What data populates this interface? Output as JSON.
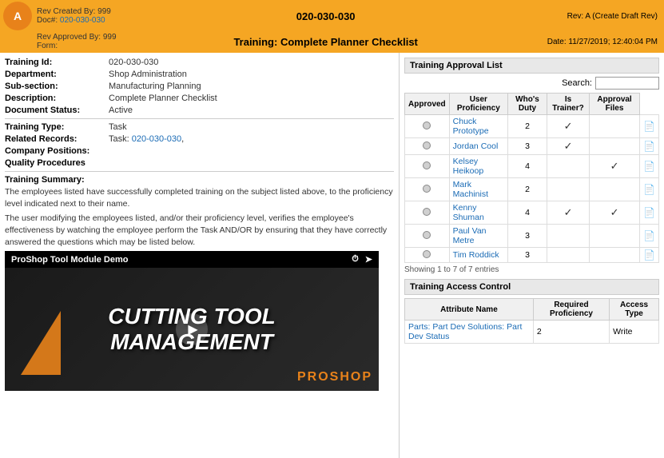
{
  "header": {
    "rev_created": "Rev Created By: 999",
    "doc_label": "Doc#:",
    "doc_number": "020-030-030",
    "rev_approved": "Rev Approved By: 999",
    "form_label": "Form:",
    "page_title": "Training: Complete Planner Checklist",
    "rev_status": "Rev: A (Create Draft Rev)",
    "date": "Date: 11/27/2019; 12:40:04 PM"
  },
  "left": {
    "training_id_label": "Training Id:",
    "training_id_value": "020-030-030",
    "department_label": "Department:",
    "department_value": "Shop Administration",
    "subsection_label": "Sub-section:",
    "subsection_value": "Manufacturing Planning",
    "description_label": "Description:",
    "description_value": "Complete Planner Checklist",
    "doc_status_label": "Document Status:",
    "doc_status_value": "Active",
    "training_type_label": "Training Type:",
    "training_type_value": "Task",
    "related_records_label": "Related Records:",
    "related_records_value": "Task: 020-030-030,",
    "related_records_link": "020-030-030",
    "company_positions_label": "Company Positions:",
    "company_positions_value": "",
    "quality_procedures_label": "Quality Procedures",
    "training_summary_label": "Training Summary:",
    "summary_text1": "The employees listed have successfully completed training on the subject listed above, to the proficiency level indicated next to their name.",
    "summary_text2": "The user modifying the employees listed, and/or their proficiency level, verifies the employee's effectiveness by watching the employee perform the Task AND/OR by ensuring that they have correctly answered the questions which may be listed below.",
    "video_title": "ProShop Tool Module Demo",
    "cutting_tool_line1": "Cutting Tool",
    "cutting_tool_line2": "Management",
    "proshop_text": "PROSHOP"
  },
  "right": {
    "approval_list_title": "Training Approval List",
    "search_label": "Search:",
    "search_placeholder": "",
    "col_approved": "Approved",
    "col_user_proficiency": "User Proficiency",
    "col_whos_duty": "Who's Duty",
    "col_is_trainer": "Is Trainer?",
    "col_approval_files": "Approval Files",
    "employees": [
      {
        "name": "Chuck Prototype",
        "proficiency": "2",
        "whos_duty": true,
        "is_trainer": false,
        "approved": false
      },
      {
        "name": "Jordan Cool",
        "proficiency": "3",
        "whos_duty": true,
        "is_trainer": false,
        "approved": false
      },
      {
        "name": "Kelsey Heikoop",
        "proficiency": "4",
        "whos_duty": false,
        "is_trainer": true,
        "approved": false
      },
      {
        "name": "Mark Machinist",
        "proficiency": "2",
        "whos_duty": false,
        "is_trainer": false,
        "approved": false
      },
      {
        "name": "Kenny Shuman",
        "proficiency": "4",
        "whos_duty": true,
        "is_trainer": true,
        "approved": false
      },
      {
        "name": "Paul Van Metre",
        "proficiency": "3",
        "whos_duty": false,
        "is_trainer": false,
        "approved": false
      },
      {
        "name": "Tim Roddick",
        "proficiency": "3",
        "whos_duty": false,
        "is_trainer": false,
        "approved": false
      }
    ],
    "showing_text": "Showing 1 to 7 of 7 entries",
    "access_control_title": "Training Access Control",
    "access_col_attribute": "Attribute Name",
    "access_col_proficiency": "Required Proficiency",
    "access_col_type": "Access Type",
    "access_items": [
      {
        "name": "Parts: Part Dev Solutions: Part Dev Status",
        "proficiency": "2",
        "type": "Write"
      }
    ]
  }
}
